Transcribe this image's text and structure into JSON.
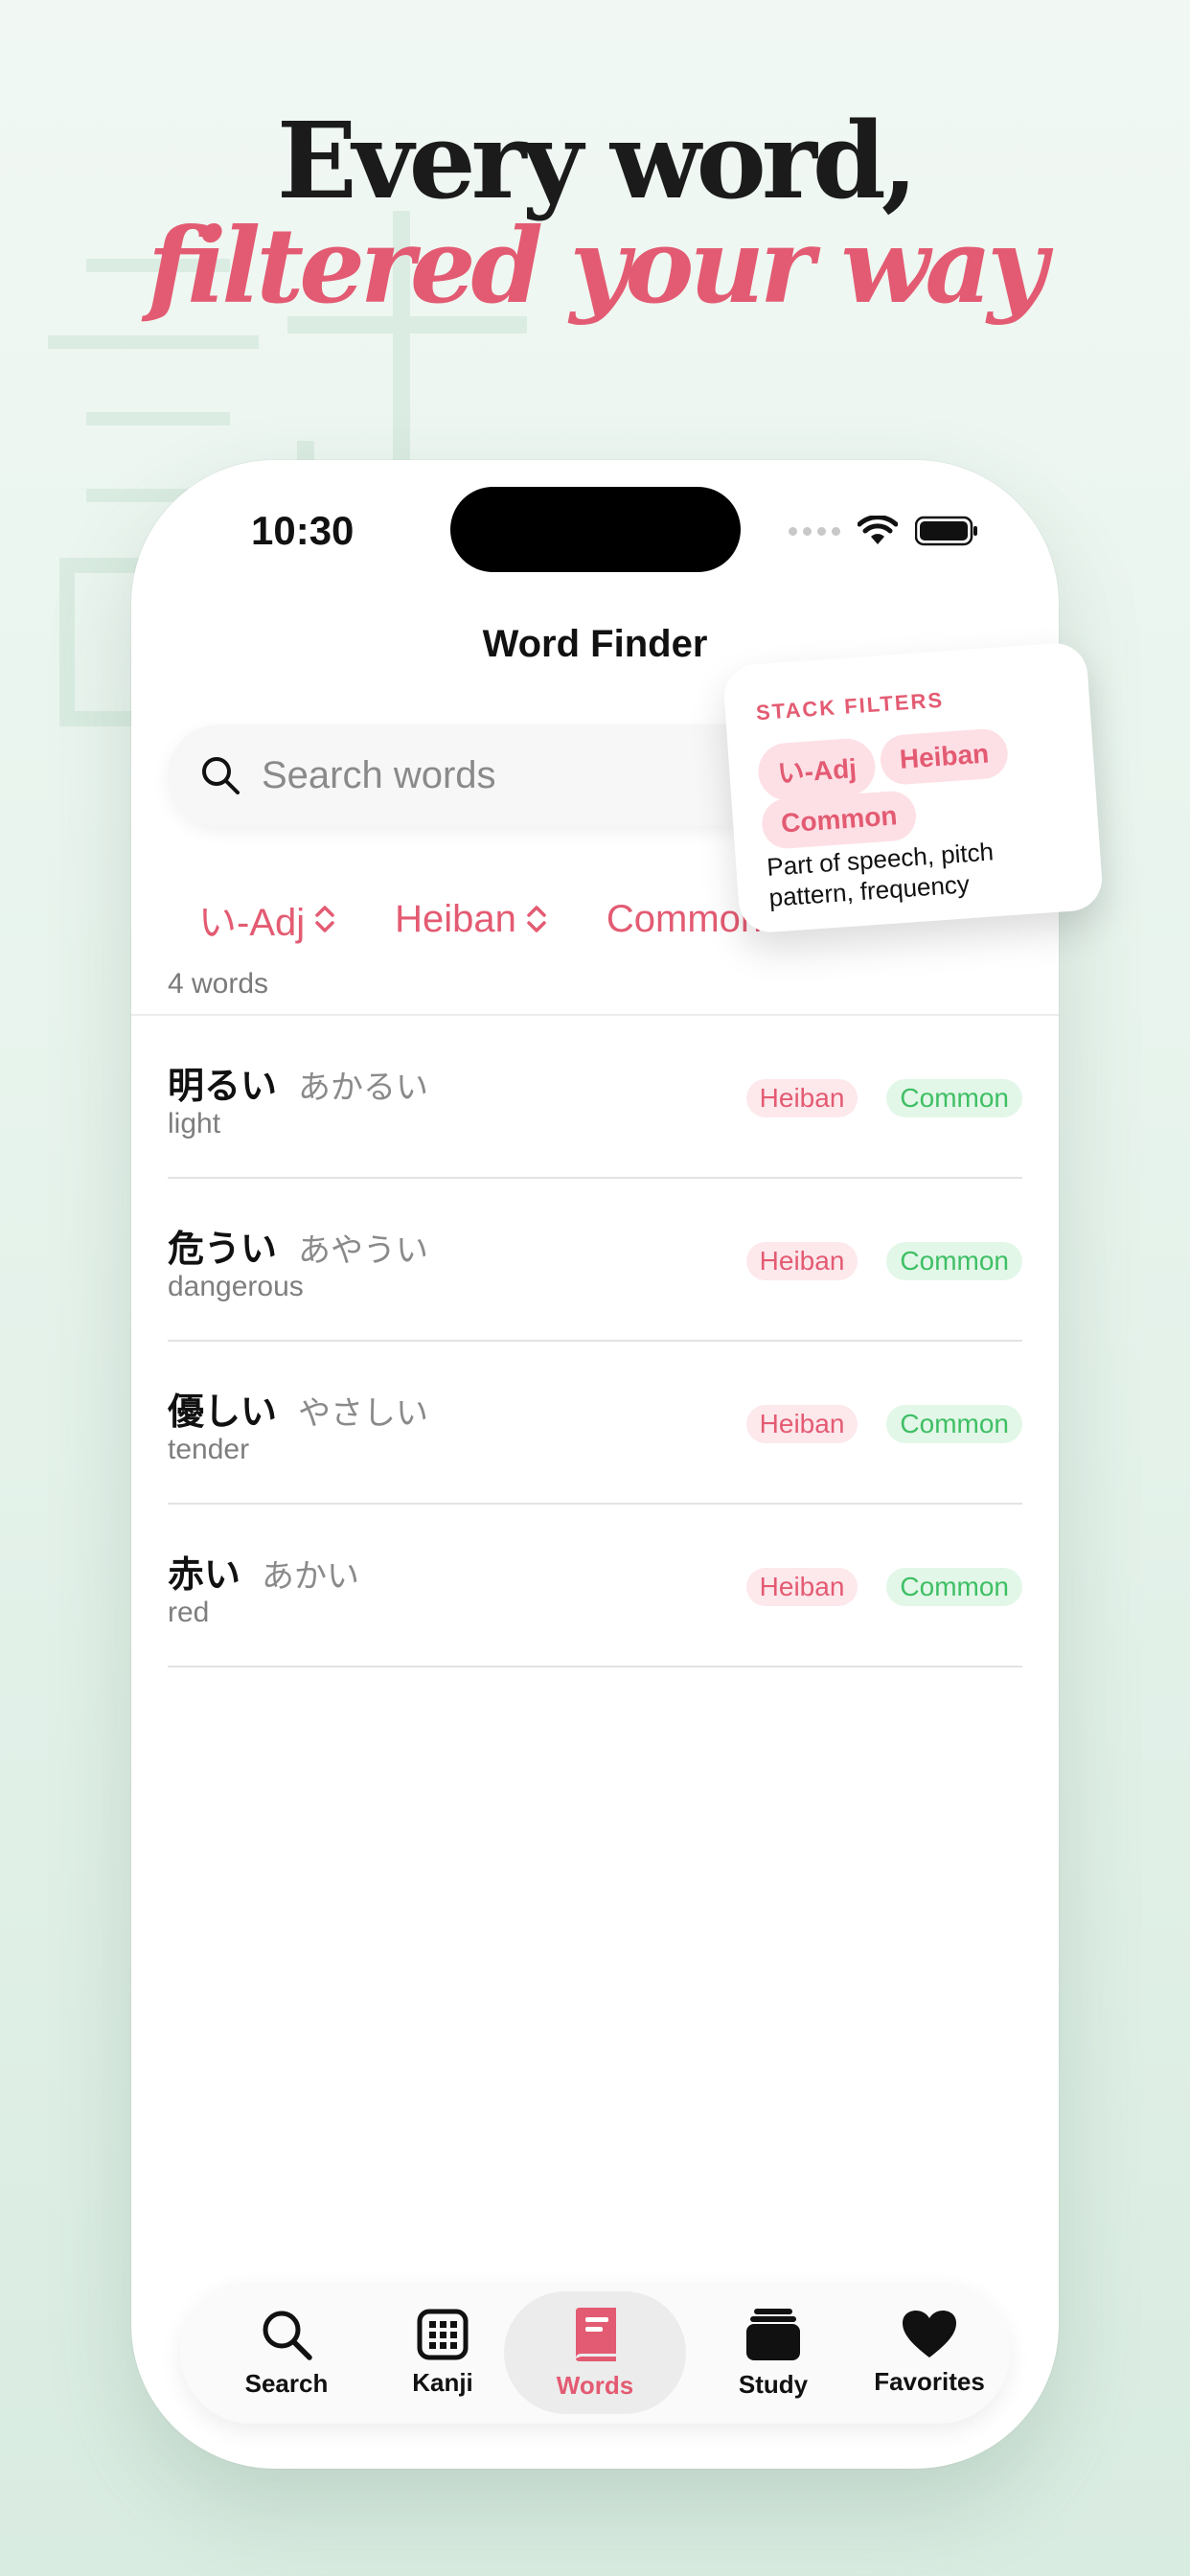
{
  "headline": {
    "line1": "Every word,",
    "line2": "filtered your way"
  },
  "status_bar": {
    "time": "10:30"
  },
  "nav": {
    "title": "Word Finder"
  },
  "search": {
    "placeholder": "Search words"
  },
  "filters": [
    "い-Adj",
    "Heiban",
    "Common"
  ],
  "results": {
    "count_label": "4 words"
  },
  "words": [
    {
      "kanji": "明るい",
      "kana": "あかるい",
      "meaning": "light",
      "pitch": "Heiban",
      "frequency": "Common"
    },
    {
      "kanji": "危うい",
      "kana": "あやうい",
      "meaning": "dangerous",
      "pitch": "Heiban",
      "frequency": "Common"
    },
    {
      "kanji": "優しい",
      "kana": "やさしい",
      "meaning": "tender",
      "pitch": "Heiban",
      "frequency": "Common"
    },
    {
      "kanji": "赤い",
      "kana": "あかい",
      "meaning": "red",
      "pitch": "Heiban",
      "frequency": "Common"
    }
  ],
  "callout": {
    "title": "STACK FILTERS",
    "chips": [
      "い-Adj",
      "Heiban",
      "Common"
    ],
    "description": "Part of speech, pitch pattern, frequency"
  },
  "tabbar": {
    "tabs": [
      {
        "label": "Search",
        "icon": "magnifier-icon"
      },
      {
        "label": "Kanji",
        "icon": "grid-icon"
      },
      {
        "label": "Words",
        "icon": "book-icon",
        "active": true
      },
      {
        "label": "Study",
        "icon": "card-stack-icon"
      },
      {
        "label": "Favorites",
        "icon": "heart-icon"
      }
    ]
  },
  "colors": {
    "accent": "#e35b72",
    "frequency": "#3fbf64",
    "background": "#e4f2ea"
  }
}
